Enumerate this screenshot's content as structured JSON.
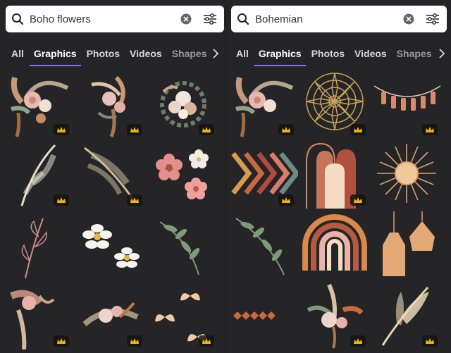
{
  "left_panel": {
    "search": {
      "value": "Boho flowers",
      "icon": "search-icon"
    },
    "tabs": [
      {
        "label": "All",
        "active": false
      },
      {
        "label": "Graphics",
        "active": true
      },
      {
        "label": "Photos",
        "active": false
      },
      {
        "label": "Videos",
        "active": false
      },
      {
        "label": "Shapes",
        "active": false
      }
    ]
  },
  "right_panel": {
    "search": {
      "value": "Bohemian",
      "icon": "search-icon"
    },
    "tabs": [
      {
        "label": "All",
        "active": false
      },
      {
        "label": "Graphics",
        "active": true
      },
      {
        "label": "Photos",
        "active": false
      },
      {
        "label": "Videos",
        "active": false
      },
      {
        "label": "Shapes",
        "active": false
      }
    ]
  },
  "colors": {
    "accent": "#8b6cff",
    "background": "#252527",
    "crown": "#f4b400"
  }
}
